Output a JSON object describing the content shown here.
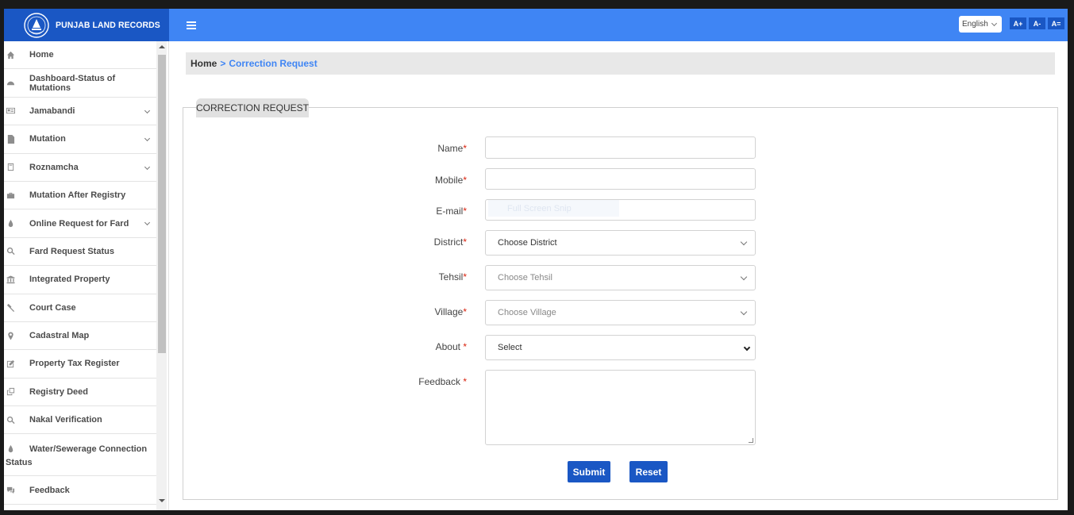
{
  "brand": {
    "title": "PUNJAB LAND RECORDS"
  },
  "topbar": {
    "language": "English",
    "font_buttons": [
      "A+",
      "A-",
      "A="
    ]
  },
  "sidebar": {
    "items": [
      {
        "label": "Home",
        "icon": "home-icon",
        "has_submenu": false
      },
      {
        "label": "Dashboard-Status of Mutations",
        "icon": "dashboard-icon",
        "has_submenu": false
      },
      {
        "label": "Jamabandi",
        "icon": "id-card-icon",
        "has_submenu": true
      },
      {
        "label": "Mutation",
        "icon": "file-icon",
        "has_submenu": true
      },
      {
        "label": "Roznamcha",
        "icon": "book-icon",
        "has_submenu": true
      },
      {
        "label": "Mutation After Registry",
        "icon": "briefcase-icon",
        "has_submenu": false
      },
      {
        "label": "Online Request for Fard",
        "icon": "drop-icon",
        "has_submenu": true
      },
      {
        "label": "Fard Request Status",
        "icon": "search-icon",
        "has_submenu": false
      },
      {
        "label": "Integrated Property",
        "icon": "bank-icon",
        "has_submenu": false
      },
      {
        "label": "Court Case",
        "icon": "gavel-icon",
        "has_submenu": false
      },
      {
        "label": "Cadastral Map",
        "icon": "map-pin-icon",
        "has_submenu": false
      },
      {
        "label": "Property Tax Register",
        "icon": "edit-icon",
        "has_submenu": false
      },
      {
        "label": "Registry Deed",
        "icon": "copy-icon",
        "has_submenu": false
      },
      {
        "label": "Nakal Verification",
        "icon": "search-icon",
        "has_submenu": false
      },
      {
        "label": "Water/Sewerage Connection Status",
        "icon": "drop-icon",
        "has_submenu": false
      },
      {
        "label": "Feedback",
        "icon": "comments-icon",
        "has_submenu": false
      }
    ]
  },
  "breadcrumb": {
    "home": "Home",
    "separator": ">",
    "current": "Correction Request"
  },
  "form": {
    "legend": "CORRECTION REQUEST",
    "required_mark": "*",
    "name_label": "Name",
    "mobile_label": "Mobile",
    "email_label": "E-mail",
    "district_label": "District",
    "tehsil_label": "Tehsil",
    "village_label": "Village",
    "about_label": "About ",
    "feedback_label": "Feedback ",
    "name_value": "",
    "mobile_value": "",
    "email_value": "",
    "district_value": "Choose District",
    "tehsil_value": "Choose Tehsil",
    "village_value": "Choose Village",
    "about_value": "Select",
    "feedback_value": "",
    "email_overlay": "Full Screen Snip",
    "submit_label": "Submit",
    "reset_label": "Reset"
  },
  "colors": {
    "topbar": "#3f85f4",
    "brand": "#1a57c4",
    "button": "#1a57c4",
    "required": "#d9230f"
  }
}
